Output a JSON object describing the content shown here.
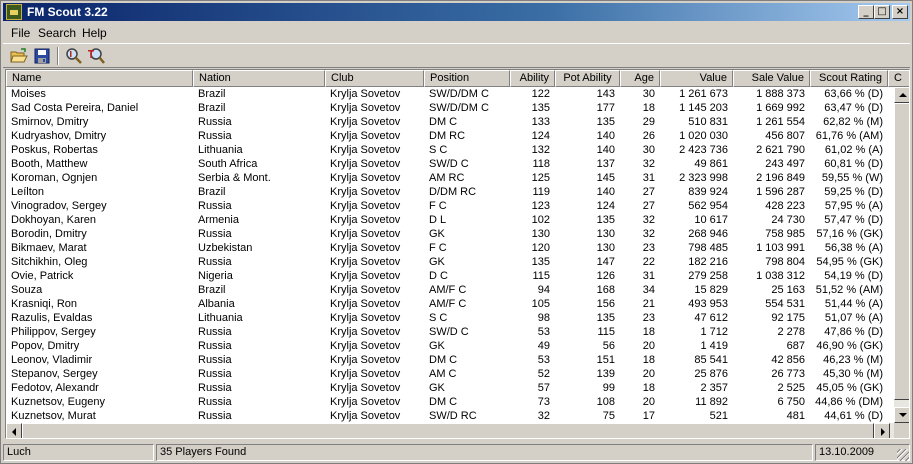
{
  "window": {
    "title": "FM Scout 3.22",
    "controls": {
      "minimize": "_",
      "maximize": "□",
      "close": "×"
    }
  },
  "menu": [
    "File",
    "Search",
    "Help"
  ],
  "toolbar": {
    "buttons": [
      {
        "name": "open",
        "icon": "open-folder-icon"
      },
      {
        "name": "save",
        "icon": "floppy-disk-icon"
      },
      {
        "name": "find-player",
        "icon": "magnifier-person-icon"
      },
      {
        "name": "find-text",
        "icon": "magnifier-text-icon"
      }
    ]
  },
  "table": {
    "columns": [
      "Name",
      "Nation",
      "Club",
      "Position",
      "Ability",
      "Pot Ability",
      "Age",
      "Value",
      "Sale Value",
      "Scout Rating",
      "C"
    ],
    "rows": [
      [
        "Moises",
        "Brazil",
        "Krylja Sovetov",
        "SW/D/DM C",
        "122",
        "143",
        "30",
        "1 261 673",
        "1 888 373",
        "63,66 % (D)"
      ],
      [
        "Sad Costa Pereira, Daniel",
        "Brazil",
        "Krylja Sovetov",
        "SW/D/DM C",
        "135",
        "177",
        "18",
        "1 145 203",
        "1 669 992",
        "63,47 % (D)"
      ],
      [
        "Smirnov, Dmitry",
        "Russia",
        "Krylja Sovetov",
        "DM C",
        "133",
        "135",
        "29",
        "510 831",
        "1 261 554",
        "62,82 % (M)"
      ],
      [
        "Kudryashov, Dmitry",
        "Russia",
        "Krylja Sovetov",
        "DM RC",
        "124",
        "140",
        "26",
        "1 020 030",
        "456 807",
        "61,76 % (AM)"
      ],
      [
        "Poskus, Robertas",
        "Lithuania",
        "Krylja Sovetov",
        "S C",
        "132",
        "140",
        "30",
        "2 423 736",
        "2 621 790",
        "61,02 % (A)"
      ],
      [
        "Booth, Matthew",
        "South Africa",
        "Krylja Sovetov",
        "SW/D C",
        "118",
        "137",
        "32",
        "49 861",
        "243 497",
        "60,81 % (D)"
      ],
      [
        "Koroman, Ognjen",
        "Serbia & Mont.",
        "Krylja Sovetov",
        "AM RC",
        "125",
        "145",
        "31",
        "2 323 998",
        "2 196 849",
        "59,55 % (W)"
      ],
      [
        "Leílton",
        "Brazil",
        "Krylja Sovetov",
        "D/DM RC",
        "119",
        "140",
        "27",
        "839 924",
        "1 596 287",
        "59,25 % (D)"
      ],
      [
        "Vinogradov, Sergey",
        "Russia",
        "Krylja Sovetov",
        "F C",
        "123",
        "124",
        "27",
        "562 954",
        "428 223",
        "57,95 % (A)"
      ],
      [
        "Dokhoyan, Karen",
        "Armenia",
        "Krylja Sovetov",
        "D L",
        "102",
        "135",
        "32",
        "10 617",
        "24 730",
        "57,47 % (D)"
      ],
      [
        "Borodin, Dmitry",
        "Russia",
        "Krylja Sovetov",
        "GK",
        "130",
        "130",
        "32",
        "268 946",
        "758 985",
        "57,16 % (GK)"
      ],
      [
        "Bikmaev, Marat",
        "Uzbekistan",
        "Krylja Sovetov",
        "F C",
        "120",
        "130",
        "23",
        "798 485",
        "1 103 991",
        "56,38 % (A)"
      ],
      [
        "Sitchikhin, Oleg",
        "Russia",
        "Krylja Sovetov",
        "GK",
        "135",
        "147",
        "22",
        "182 216",
        "798 804",
        "54,95 % (GK)"
      ],
      [
        "Ovie, Patrick",
        "Nigeria",
        "Krylja Sovetov",
        "D C",
        "115",
        "126",
        "31",
        "279 258",
        "1 038 312",
        "54,19 % (D)"
      ],
      [
        "Souza",
        "Brazil",
        "Krylja Sovetov",
        "AM/F C",
        "94",
        "168",
        "34",
        "15 829",
        "25 163",
        "51,52 % (AM)"
      ],
      [
        "Krasniqi, Ron",
        "Albania",
        "Krylja Sovetov",
        "AM/F C",
        "105",
        "156",
        "21",
        "493 953",
        "554 531",
        "51,44 % (A)"
      ],
      [
        "Razulis, Evaldas",
        "Lithuania",
        "Krylja Sovetov",
        "S C",
        "98",
        "135",
        "23",
        "47 612",
        "92 175",
        "51,07 % (A)"
      ],
      [
        "Philippov, Sergey",
        "Russia",
        "Krylja Sovetov",
        "SW/D C",
        "53",
        "115",
        "18",
        "1 712",
        "2 278",
        "47,86 % (D)"
      ],
      [
        "Popov, Dmitry",
        "Russia",
        "Krylja Sovetov",
        "GK",
        "49",
        "56",
        "20",
        "1 419",
        "687",
        "46,90 % (GK)"
      ],
      [
        "Leonov, Vladimir",
        "Russia",
        "Krylja Sovetov",
        "DM C",
        "53",
        "151",
        "18",
        "85 541",
        "42 856",
        "46,23 % (M)"
      ],
      [
        "Stepanov, Sergey",
        "Russia",
        "Krylja Sovetov",
        "AM C",
        "52",
        "139",
        "20",
        "25 876",
        "26 773",
        "45,30 % (M)"
      ],
      [
        "Fedotov, Alexandr",
        "Russia",
        "Krylja Sovetov",
        "GK",
        "57",
        "99",
        "18",
        "2 357",
        "2 525",
        "45,05 % (GK)"
      ],
      [
        "Kuznetsov, Eugeny",
        "Russia",
        "Krylja Sovetov",
        "DM C",
        "73",
        "108",
        "20",
        "11 892",
        "6 750",
        "44,86 % (DM)"
      ],
      [
        "Kuznetsov, Murat",
        "Russia",
        "Krylja Sovetov",
        "SW/D RC",
        "32",
        "75",
        "17",
        "521",
        "481",
        "44,61 % (D)"
      ]
    ]
  },
  "status": {
    "left": "Luch",
    "middle": "35 Players Found",
    "right": "13.10.2009"
  }
}
